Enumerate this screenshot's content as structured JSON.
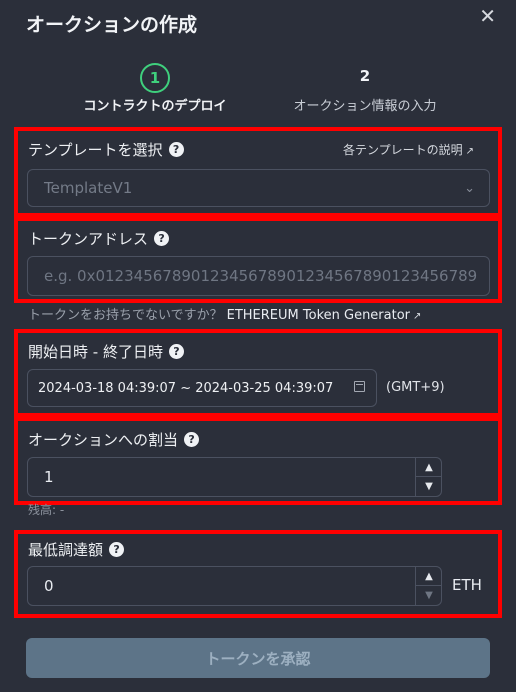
{
  "modal": {
    "title": "オークションの作成",
    "close_label": "✕"
  },
  "stepper": {
    "steps": [
      {
        "number": "1",
        "label": "コントラクトのデプロイ",
        "active": true
      },
      {
        "number": "2",
        "label": "オークション情報の入力",
        "active": false
      }
    ],
    "active_color": "#3fd07d"
  },
  "template": {
    "label": "テンプレートを選択",
    "help": "?",
    "link_text": "各テンプレートの説明",
    "selected_value": "TemplateV1"
  },
  "token_address": {
    "label": "トークンアドレス",
    "help": "?",
    "placeholder": "e.g. 0x0123456789012345678901234567890123456789",
    "hint_text": "トークンをお持ちでないですか？",
    "generator_link": "ETHEREUM Token Generator"
  },
  "period": {
    "label": "開始日時 - 終了日時",
    "help": "?",
    "value": "2024-03-18 04:39:07 ~ 2024-03-25 04:39:07",
    "timezone": "(GMT+9)"
  },
  "allocation": {
    "label": "オークションへの割当",
    "help": "?",
    "value": "1",
    "balance_text": "残高: -"
  },
  "minimum": {
    "label": "最低調達額",
    "help": "?",
    "value": "0",
    "unit": "ETH"
  },
  "actions": {
    "approve_label": "トークンを承認"
  },
  "icons": {
    "close": "close-icon",
    "help": "question-circle-icon",
    "external": "external-link-icon",
    "chevron": "chevron-down-icon",
    "calendar": "calendar-icon",
    "spin_up": "triangle-up-icon",
    "spin_down": "triangle-down-icon"
  },
  "colors": {
    "background": "#2b2f3a",
    "highlight_border": "#ff0000",
    "button_disabled": "#5d7488"
  }
}
